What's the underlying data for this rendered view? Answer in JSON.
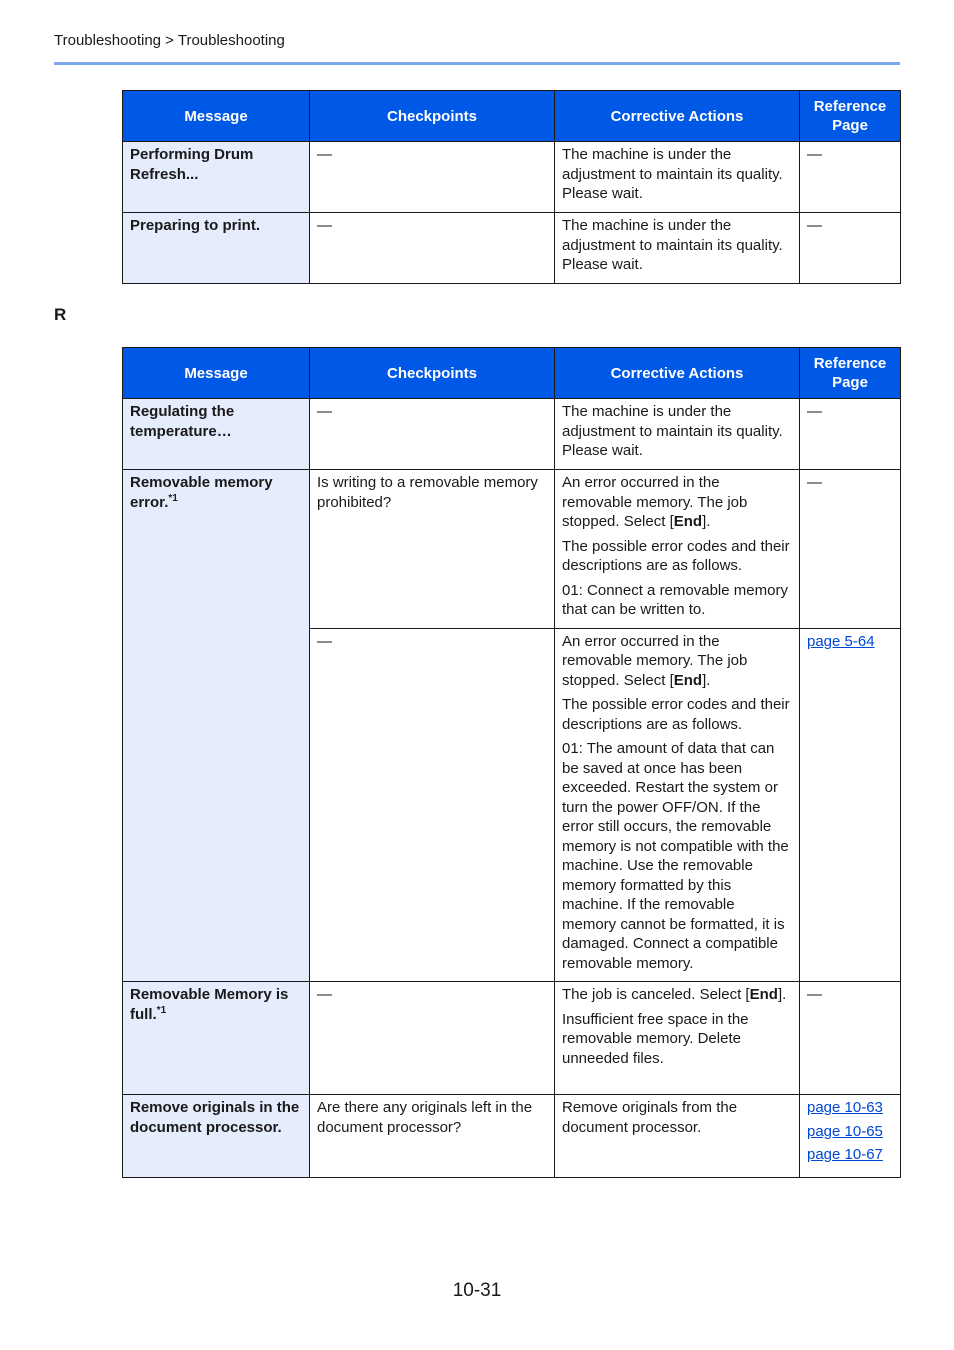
{
  "breadcrumb": "Troubleshooting > Troubleshooting",
  "colors": {
    "header_bg": "#0058e6",
    "message_cell_bg": "#e5ecfc",
    "rule": "#7aa7ef",
    "link": "#0047d6"
  },
  "columns": [
    "Message",
    "Checkpoints",
    "Corrective Actions",
    "Reference Page"
  ],
  "section_letter": "R",
  "table1": {
    "rows": [
      {
        "message": "Performing Drum Refresh...",
        "checkpoint": "—",
        "actions": [
          "The machine is under the adjustment to maintain its quality. Please wait."
        ],
        "ref": "—"
      },
      {
        "message": "Preparing to print.",
        "checkpoint": "—",
        "actions": [
          "The machine is under the adjustment to maintain its quality. Please wait."
        ],
        "ref": "—"
      }
    ]
  },
  "table2": {
    "regulating": {
      "message": "Regulating the temperature…",
      "checkpoint": "—",
      "action": "The machine is under the adjustment to maintain its quality. Please wait.",
      "ref": "—"
    },
    "removable_error": {
      "message": "Removable memory error.",
      "footnote": "*1",
      "sub1": {
        "checkpoint": "Is writing to a removable memory prohibited?",
        "action_1_prefix": "An error occurred in the removable memory. The job stopped. Select [",
        "action_1_bold": "End",
        "action_1_suffix": "].",
        "action_2": "The possible error codes and their descriptions are as follows.",
        "action_3": "01: Connect a removable memory that can be written to.",
        "ref": "—"
      },
      "sub2": {
        "checkpoint": "—",
        "action_1_prefix": "An error occurred in the removable memory. The job stopped. Select [",
        "action_1_bold": "End",
        "action_1_suffix": "].",
        "action_2": "The possible error codes and their descriptions are as follows.",
        "action_3": "01: The amount of data that can be saved at once has been exceeded. Restart the system or turn the power OFF/ON. If the error still occurs, the removable memory is not compatible with the machine. Use the removable memory formatted by this machine. If the removable memory cannot be formatted, it is damaged. Connect a compatible removable memory.",
        "ref_link": "page 5-64"
      }
    },
    "removable_full": {
      "message": "Removable Memory is full.",
      "footnote": "*1",
      "checkpoint": "—",
      "action_1_prefix": "The job is canceled. Select [",
      "action_1_bold": "End",
      "action_1_suffix": "].",
      "action_2": "Insufficient free space in the removable memory. Delete unneeded files.",
      "ref": "—"
    },
    "remove_originals": {
      "message": "Remove originals in the document processor.",
      "checkpoint": "Are there any originals left in the document processor?",
      "action": "Remove originals from the document processor.",
      "ref_links": [
        "page 10-63",
        "page 10-65",
        "page 10-67"
      ]
    }
  },
  "page_number": "10-31"
}
